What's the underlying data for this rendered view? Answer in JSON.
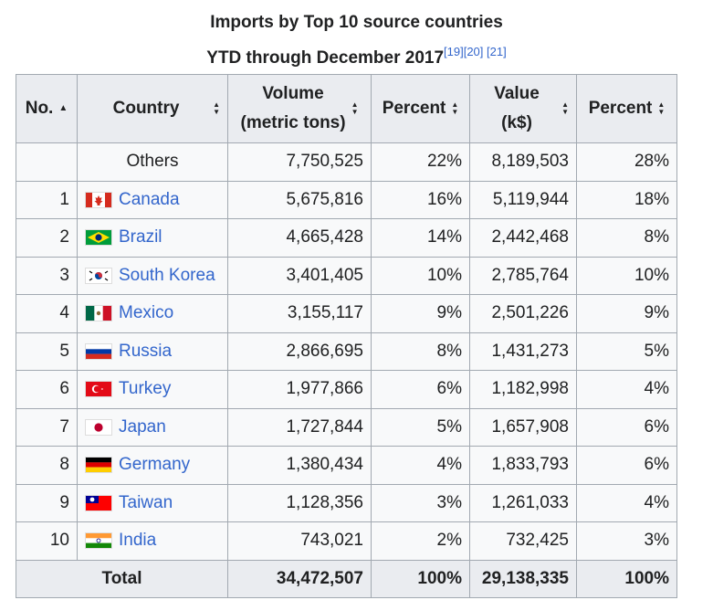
{
  "caption": {
    "line1": "Imports by Top 10 source countries",
    "line2": "YTD through December 2017",
    "refs": [
      "[19]",
      "[20]",
      "[21]"
    ]
  },
  "headers": {
    "no": "No.",
    "country": "Country",
    "volume": [
      "Volume",
      "(metric tons)"
    ],
    "percent1": "Percent",
    "value": [
      "Value",
      "(k$)"
    ],
    "percent2": "Percent"
  },
  "rows": [
    {
      "no": "",
      "country": "Others",
      "flag": "",
      "volume": "7,750,525",
      "vol_pct": "22%",
      "value": "8,189,503",
      "val_pct": "28%"
    },
    {
      "no": "1",
      "country": "Canada",
      "flag": "canada-flag-icon",
      "volume": "5,675,816",
      "vol_pct": "16%",
      "value": "5,119,944",
      "val_pct": "18%"
    },
    {
      "no": "2",
      "country": "Brazil",
      "flag": "brazil-flag-icon",
      "volume": "4,665,428",
      "vol_pct": "14%",
      "value": "2,442,468",
      "val_pct": "8%"
    },
    {
      "no": "3",
      "country": "South Korea",
      "flag": "south-korea-flag-icon",
      "volume": "3,401,405",
      "vol_pct": "10%",
      "value": "2,785,764",
      "val_pct": "10%"
    },
    {
      "no": "4",
      "country": "Mexico",
      "flag": "mexico-flag-icon",
      "volume": "3,155,117",
      "vol_pct": "9%",
      "value": "2,501,226",
      "val_pct": "9%"
    },
    {
      "no": "5",
      "country": "Russia",
      "flag": "russia-flag-icon",
      "volume": "2,866,695",
      "vol_pct": "8%",
      "value": "1,431,273",
      "val_pct": "5%"
    },
    {
      "no": "6",
      "country": "Turkey",
      "flag": "turkey-flag-icon",
      "volume": "1,977,866",
      "vol_pct": "6%",
      "value": "1,182,998",
      "val_pct": "4%"
    },
    {
      "no": "7",
      "country": "Japan",
      "flag": "japan-flag-icon",
      "volume": "1,727,844",
      "vol_pct": "5%",
      "value": "1,657,908",
      "val_pct": "6%"
    },
    {
      "no": "8",
      "country": "Germany",
      "flag": "germany-flag-icon",
      "volume": "1,380,434",
      "vol_pct": "4%",
      "value": "1,833,793",
      "val_pct": "6%"
    },
    {
      "no": "9",
      "country": "Taiwan",
      "flag": "taiwan-flag-icon",
      "volume": "1,128,356",
      "vol_pct": "3%",
      "value": "1,261,033",
      "val_pct": "4%"
    },
    {
      "no": "10",
      "country": "India",
      "flag": "india-flag-icon",
      "volume": "743,021",
      "vol_pct": "2%",
      "value": "732,425",
      "val_pct": "3%"
    }
  ],
  "total": {
    "label": "Total",
    "volume": "34,472,507",
    "vol_pct": "100%",
    "value": "29,138,335",
    "val_pct": "100%"
  },
  "colors": {
    "header_bg": "#eaecf0",
    "cell_bg": "#f8f9fa",
    "border": "#a2a9b1",
    "link": "#3366cc"
  }
}
